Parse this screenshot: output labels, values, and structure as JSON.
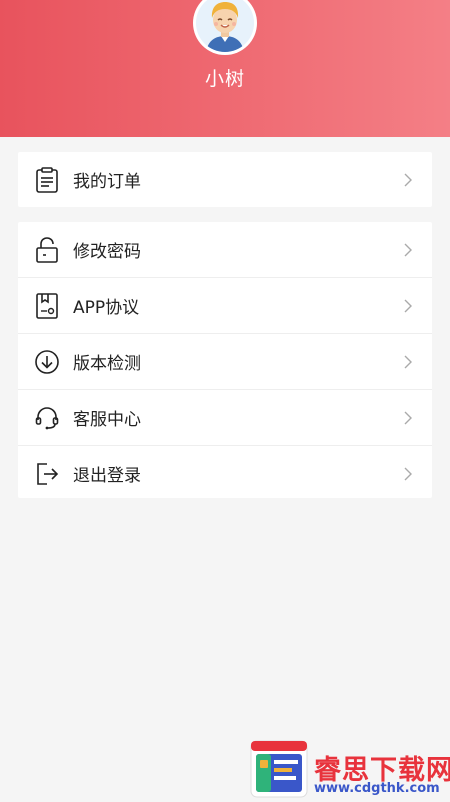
{
  "header": {
    "username": "小树",
    "gradient_colors": [
      "#e8535d",
      "#f47f86"
    ]
  },
  "menu_orders": [
    {
      "label": "我的订单",
      "icon": "clipboard-icon"
    }
  ],
  "menu_settings": [
    {
      "label": "修改密码",
      "icon": "unlock-icon"
    },
    {
      "label": "APP协议",
      "icon": "agreement-icon"
    },
    {
      "label": "版本检测",
      "icon": "download-circle-icon"
    },
    {
      "label": "客服中心",
      "icon": "headset-icon"
    },
    {
      "label": "退出登录",
      "icon": "logout-icon"
    }
  ],
  "watermark": {
    "title": "睿思下载网",
    "url": "www.cdgthk.com"
  }
}
